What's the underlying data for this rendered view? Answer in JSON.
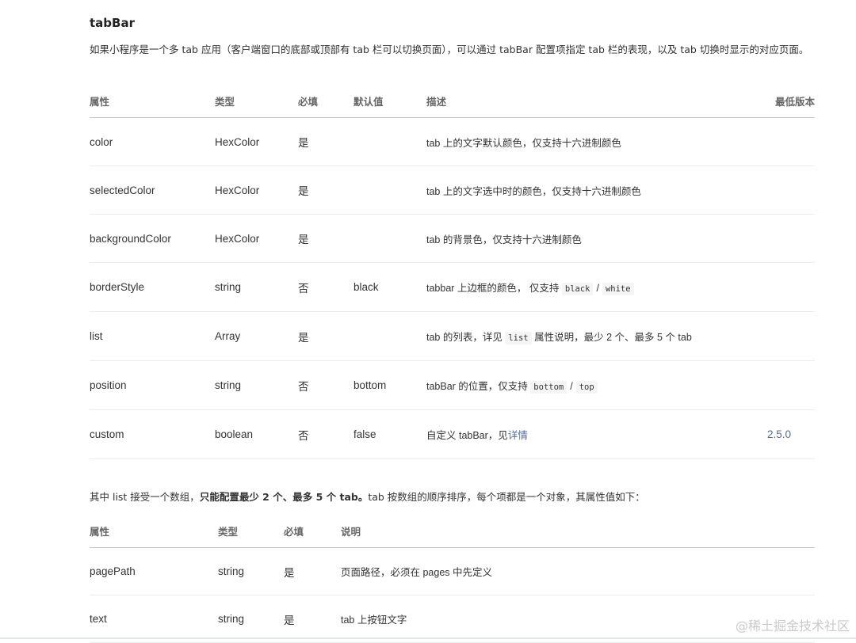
{
  "title": "tabBar",
  "intro": "如果小程序是一个多 tab 应用（客户端窗口的底部或顶部有 tab 栏可以切换页面），可以通过 tabBar 配置项指定 tab 栏的表现，以及 tab 切换时显示的对应页面。",
  "table1": {
    "headers": {
      "prop": "属性",
      "type": "类型",
      "required": "必填",
      "default": "默认值",
      "desc": "描述",
      "version": "最低版本"
    },
    "rows": [
      {
        "prop": "color",
        "type": "HexColor",
        "required": "是",
        "default": "",
        "desc": "tab 上的文字默认颜色，仅支持十六进制颜色",
        "version": ""
      },
      {
        "prop": "selectedColor",
        "type": "HexColor",
        "required": "是",
        "default": "",
        "desc": "tab 上的文字选中时的颜色，仅支持十六进制颜色",
        "version": ""
      },
      {
        "prop": "backgroundColor",
        "type": "HexColor",
        "required": "是",
        "default": "",
        "desc": "tab 的背景色，仅支持十六进制颜色",
        "version": ""
      },
      {
        "prop": "borderStyle",
        "type": "string",
        "required": "否",
        "default": "black",
        "desc_prefix": "tabbar 上边框的颜色， 仅支持",
        "code_a": "black",
        "sep": "/",
        "code_b": "white",
        "version": ""
      },
      {
        "prop": "list",
        "type": "Array",
        "required": "是",
        "default": "",
        "desc_prefix": "tab 的列表，详见",
        "code_a": "list",
        "desc_suffix": "属性说明，最少 2 个、最多 5 个 tab",
        "version": ""
      },
      {
        "prop": "position",
        "type": "string",
        "required": "否",
        "default": "bottom",
        "desc_prefix": "tabBar 的位置，仅支持",
        "code_a": "bottom",
        "sep": "/",
        "code_b": "top",
        "version": ""
      },
      {
        "prop": "custom",
        "type": "boolean",
        "required": "否",
        "default": "false",
        "desc_prefix": "自定义 tabBar，见",
        "link": "详情",
        "version": "2.5.0"
      }
    ]
  },
  "para2": {
    "a": "其中 list 接受一个数组，",
    "b": "只能配置最少 2 个、最多 5 个 tab。",
    "c": "tab 按数组的顺序排序，每个项都是一个对象，其属性值如下："
  },
  "table2": {
    "headers": {
      "prop": "属性",
      "type": "类型",
      "required": "必填",
      "desc": "说明"
    },
    "rows": [
      {
        "prop": "pagePath",
        "type": "string",
        "required": "是",
        "desc": "页面路径，必须在 pages 中先定义"
      },
      {
        "prop": "text",
        "type": "string",
        "required": "是",
        "desc": "tab 上按钮文字"
      }
    ]
  },
  "watermark": "@稀土掘金技术社区",
  "colors": {
    "link": "#576b95",
    "text": "#333333",
    "header": "#666666",
    "code_bg": "#f5f5f5"
  }
}
